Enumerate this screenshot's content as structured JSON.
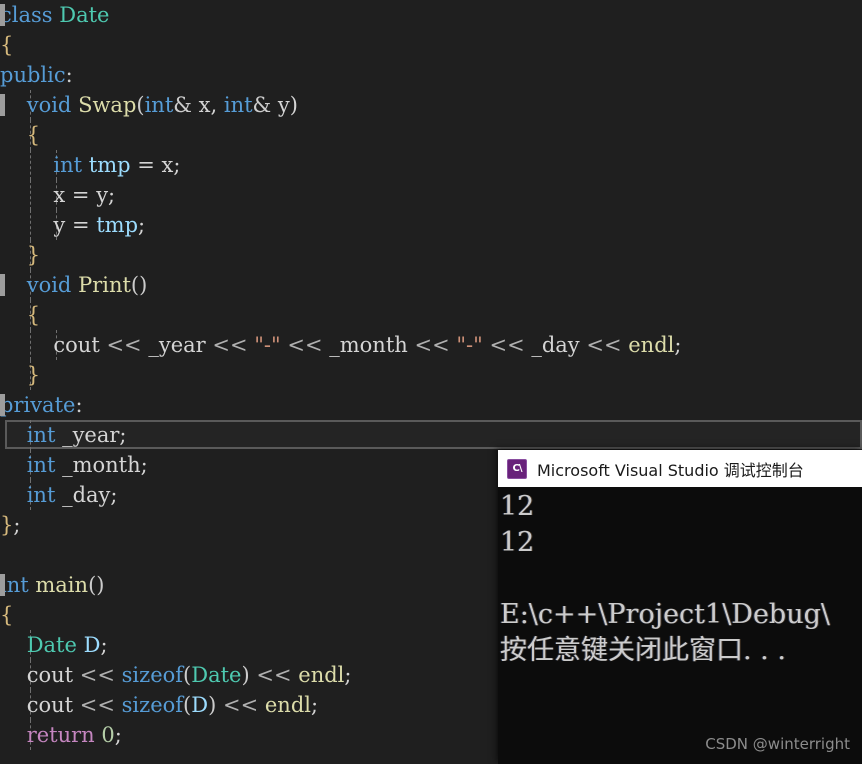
{
  "editor": {
    "name": "visual-studio-code-editor",
    "theme_background": "#1f1f1f",
    "lines": [
      {
        "text": "class Date",
        "indent": 0
      },
      {
        "text": "{",
        "indent": 0
      },
      {
        "text": "public:",
        "indent": 0
      },
      {
        "text": "    void Swap(int& x, int& y)",
        "indent": 1
      },
      {
        "text": "    {",
        "indent": 1
      },
      {
        "text": "        int tmp = x;",
        "indent": 2
      },
      {
        "text": "        x = y;",
        "indent": 2
      },
      {
        "text": "        y = tmp;",
        "indent": 2
      },
      {
        "text": "    }",
        "indent": 1
      },
      {
        "text": "    void Print()",
        "indent": 1
      },
      {
        "text": "    {",
        "indent": 1
      },
      {
        "text": "        cout << _year << \"-\" << _month << \"-\" << _day << endl;",
        "indent": 2
      },
      {
        "text": "    }",
        "indent": 1
      },
      {
        "text": "private:",
        "indent": 0
      },
      {
        "text": "    int _year;",
        "indent": 1
      },
      {
        "text": "    int _month;",
        "indent": 1
      },
      {
        "text": "    int _day;",
        "indent": 1
      },
      {
        "text": "};",
        "indent": 0
      },
      {
        "text": "",
        "indent": 0
      },
      {
        "text": "int main()",
        "indent": 0
      },
      {
        "text": "{",
        "indent": 0
      },
      {
        "text": "    Date D;",
        "indent": 1
      },
      {
        "text": "    cout << sizeof(Date) << endl;",
        "indent": 1
      },
      {
        "text": "    cout << sizeof(D) << endl;",
        "indent": 1
      },
      {
        "text": "    return 0;",
        "indent": 1
      }
    ],
    "tokens": {
      "line0": [
        {
          "t": "class",
          "c": "kw"
        },
        {
          "t": " ",
          "c": "plain"
        },
        {
          "t": "Date",
          "c": "type"
        }
      ],
      "line1": [
        {
          "t": "{",
          "c": "brace"
        }
      ],
      "line2": [
        {
          "t": "public",
          "c": "kw"
        },
        {
          "t": ":",
          "c": "punct"
        }
      ],
      "line3": [
        {
          "t": "    ",
          "c": "plain"
        },
        {
          "t": "void",
          "c": "kw"
        },
        {
          "t": " ",
          "c": "plain"
        },
        {
          "t": "Swap",
          "c": "fn"
        },
        {
          "t": "(",
          "c": "punct"
        },
        {
          "t": "int",
          "c": "kw"
        },
        {
          "t": "&",
          "c": "punct"
        },
        {
          "t": " x, ",
          "c": "plain"
        },
        {
          "t": "int",
          "c": "kw"
        },
        {
          "t": "&",
          "c": "punct"
        },
        {
          "t": " y)",
          "c": "plain"
        }
      ],
      "line4": [
        {
          "t": "    ",
          "c": "plain"
        },
        {
          "t": "{",
          "c": "brace"
        }
      ],
      "line5": [
        {
          "t": "        ",
          "c": "plain"
        },
        {
          "t": "int",
          "c": "kw"
        },
        {
          "t": " ",
          "c": "plain"
        },
        {
          "t": "tmp",
          "c": "var"
        },
        {
          "t": " = x;",
          "c": "plain"
        }
      ],
      "line6": [
        {
          "t": "        x = y;",
          "c": "plain"
        }
      ],
      "line7": [
        {
          "t": "        y = ",
          "c": "plain"
        },
        {
          "t": "tmp",
          "c": "var"
        },
        {
          "t": ";",
          "c": "plain"
        }
      ],
      "line8": [
        {
          "t": "    ",
          "c": "plain"
        },
        {
          "t": "}",
          "c": "brace"
        }
      ],
      "line9": [
        {
          "t": "    ",
          "c": "plain"
        },
        {
          "t": "void",
          "c": "kw"
        },
        {
          "t": " ",
          "c": "plain"
        },
        {
          "t": "Print",
          "c": "fn"
        },
        {
          "t": "()",
          "c": "punct"
        }
      ],
      "line10": [
        {
          "t": "    ",
          "c": "plain"
        },
        {
          "t": "{",
          "c": "brace"
        }
      ],
      "line11": [
        {
          "t": "        cout ",
          "c": "plain"
        },
        {
          "t": "<<",
          "c": "op"
        },
        {
          "t": " _year ",
          "c": "plain"
        },
        {
          "t": "<<",
          "c": "op"
        },
        {
          "t": " ",
          "c": "plain"
        },
        {
          "t": "\"-\"",
          "c": "str"
        },
        {
          "t": " ",
          "c": "plain"
        },
        {
          "t": "<<",
          "c": "op"
        },
        {
          "t": " _month ",
          "c": "plain"
        },
        {
          "t": "<<",
          "c": "op"
        },
        {
          "t": " ",
          "c": "plain"
        },
        {
          "t": "\"-\"",
          "c": "str"
        },
        {
          "t": " ",
          "c": "plain"
        },
        {
          "t": "<<",
          "c": "op"
        },
        {
          "t": " _day ",
          "c": "plain"
        },
        {
          "t": "<<",
          "c": "op"
        },
        {
          "t": " ",
          "c": "plain"
        },
        {
          "t": "endl",
          "c": "endl"
        },
        {
          "t": ";",
          "c": "plain"
        }
      ],
      "line12": [
        {
          "t": "    ",
          "c": "plain"
        },
        {
          "t": "}",
          "c": "brace"
        }
      ],
      "line13": [
        {
          "t": "private",
          "c": "kw"
        },
        {
          "t": ":",
          "c": "punct"
        }
      ],
      "line14": [
        {
          "t": "    ",
          "c": "plain"
        },
        {
          "t": "int",
          "c": "kw"
        },
        {
          "t": " _year;",
          "c": "plain"
        }
      ],
      "line15": [
        {
          "t": "    ",
          "c": "plain"
        },
        {
          "t": "int",
          "c": "kw"
        },
        {
          "t": " _month;",
          "c": "plain"
        }
      ],
      "line16": [
        {
          "t": "    ",
          "c": "plain"
        },
        {
          "t": "int",
          "c": "kw"
        },
        {
          "t": " _day;",
          "c": "plain"
        }
      ],
      "line17": [
        {
          "t": "}",
          "c": "brace"
        },
        {
          "t": ";",
          "c": "plain"
        }
      ],
      "line18": [
        {
          "t": "",
          "c": "plain"
        }
      ],
      "line19": [
        {
          "t": "int",
          "c": "kw"
        },
        {
          "t": " ",
          "c": "plain"
        },
        {
          "t": "main",
          "c": "fn"
        },
        {
          "t": "()",
          "c": "punct"
        }
      ],
      "line20": [
        {
          "t": "{",
          "c": "brace"
        }
      ],
      "line21": [
        {
          "t": "    ",
          "c": "plain"
        },
        {
          "t": "Date",
          "c": "type"
        },
        {
          "t": " ",
          "c": "plain"
        },
        {
          "t": "D",
          "c": "var"
        },
        {
          "t": ";",
          "c": "plain"
        }
      ],
      "line22": [
        {
          "t": "    cout ",
          "c": "plain"
        },
        {
          "t": "<<",
          "c": "op"
        },
        {
          "t": " ",
          "c": "plain"
        },
        {
          "t": "sizeof",
          "c": "kw"
        },
        {
          "t": "(",
          "c": "punct"
        },
        {
          "t": "Date",
          "c": "type"
        },
        {
          "t": ")",
          "c": "punct"
        },
        {
          "t": " ",
          "c": "plain"
        },
        {
          "t": "<<",
          "c": "op"
        },
        {
          "t": " ",
          "c": "plain"
        },
        {
          "t": "endl",
          "c": "endl"
        },
        {
          "t": ";",
          "c": "plain"
        }
      ],
      "line23": [
        {
          "t": "    cout ",
          "c": "plain"
        },
        {
          "t": "<<",
          "c": "op"
        },
        {
          "t": " ",
          "c": "plain"
        },
        {
          "t": "sizeof",
          "c": "kw"
        },
        {
          "t": "(",
          "c": "punct"
        },
        {
          "t": "D",
          "c": "var"
        },
        {
          "t": ")",
          "c": "punct"
        },
        {
          "t": " ",
          "c": "plain"
        },
        {
          "t": "<<",
          "c": "op"
        },
        {
          "t": " ",
          "c": "plain"
        },
        {
          "t": "endl",
          "c": "endl"
        },
        {
          "t": ";",
          "c": "plain"
        }
      ],
      "line24": [
        {
          "t": "    ",
          "c": "plain"
        },
        {
          "t": "return",
          "c": "ret"
        },
        {
          "t": " ",
          "c": "plain"
        },
        {
          "t": "0",
          "c": "num"
        },
        {
          "t": ";",
          "c": "plain"
        }
      ]
    },
    "current_line_index": 14,
    "edge_marker_lines": [
      0,
      3,
      9,
      13,
      19
    ]
  },
  "console": {
    "title": "Microsoft Visual Studio 调试控制台",
    "icon": "visual-studio-console-icon",
    "icon_glyph": "C\\",
    "titlebar_color": "#ffffff",
    "body_color": "#0c0c0c",
    "output": [
      "12",
      "12",
      "",
      "E:\\c++\\Project1\\Debug\\",
      "按任意键关闭此窗口. . ."
    ]
  },
  "watermark": {
    "text": "CSDN @winterright"
  }
}
